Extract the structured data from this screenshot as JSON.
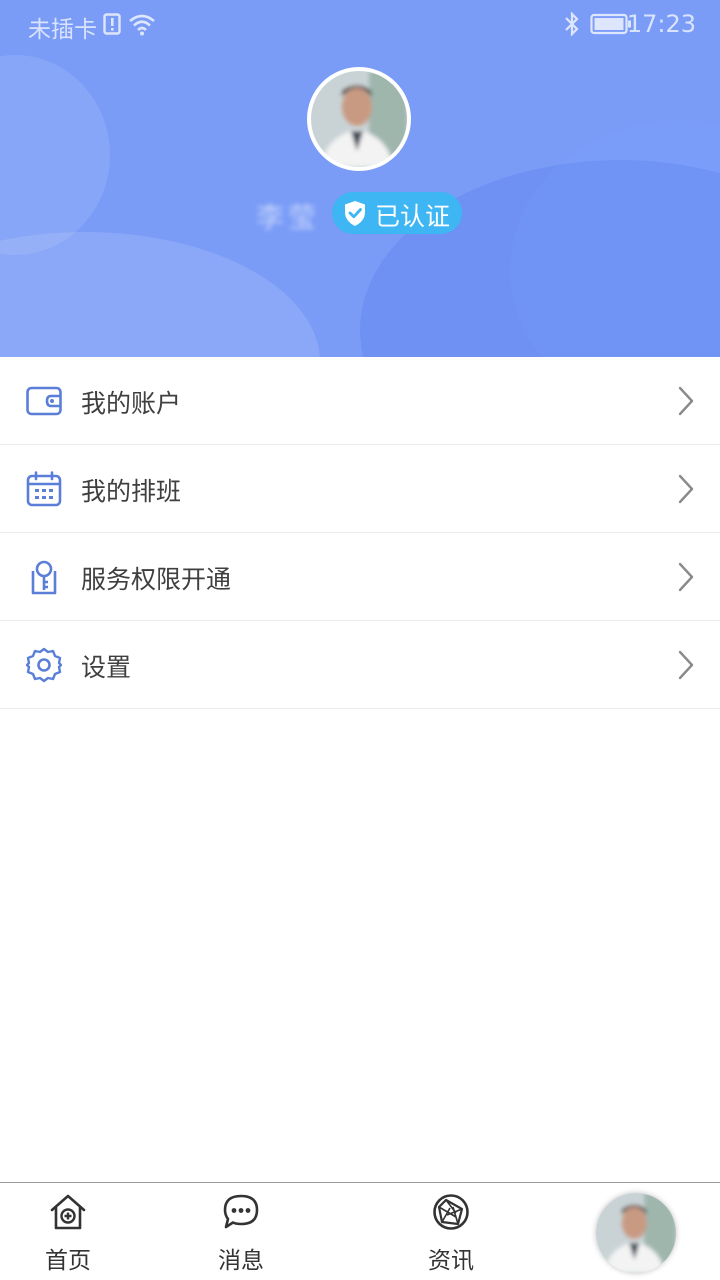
{
  "status_bar": {
    "carrier": "未插卡",
    "time": "17:23"
  },
  "profile": {
    "name": "李莹",
    "verified_label": "已认证"
  },
  "menu": {
    "items": [
      {
        "label": "我的账户",
        "icon": "wallet-icon"
      },
      {
        "label": "我的排班",
        "icon": "calendar-icon"
      },
      {
        "label": "服务权限开通",
        "icon": "key-icon"
      },
      {
        "label": "设置",
        "icon": "gear-icon"
      }
    ]
  },
  "tabbar": {
    "tabs": [
      {
        "label": "首页",
        "icon": "home-medical-icon"
      },
      {
        "label": "消息",
        "icon": "chat-bubble-icon"
      },
      {
        "label": "资讯",
        "icon": "aperture-icon"
      },
      {
        "label": "",
        "icon": "avatar"
      }
    ]
  },
  "colors": {
    "header_bg": "#7a9cf7",
    "badge_bg": "#3db6f3",
    "icon_blue": "#5b7fd8",
    "text_primary": "#3f3f3f"
  }
}
